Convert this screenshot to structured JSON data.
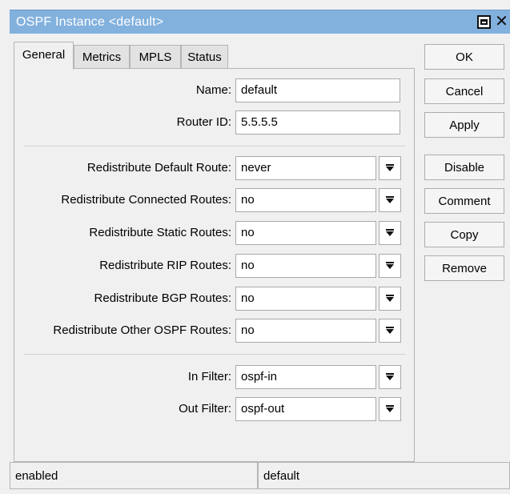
{
  "window": {
    "title": "OSPF Instance <default>",
    "title_bar_color": "#82b1de"
  },
  "tabs": [
    {
      "label": "General",
      "active": true
    },
    {
      "label": "Metrics",
      "active": false
    },
    {
      "label": "MPLS",
      "active": false
    },
    {
      "label": "Status",
      "active": false
    }
  ],
  "form": {
    "name": {
      "label": "Name:",
      "value": "default"
    },
    "router_id": {
      "label": "Router ID:",
      "value": "5.5.5.5"
    },
    "redistribute_default": {
      "label": "Redistribute Default Route:",
      "value": "never"
    },
    "redistribute_connected": {
      "label": "Redistribute Connected Routes:",
      "value": "no"
    },
    "redistribute_static": {
      "label": "Redistribute Static Routes:",
      "value": "no"
    },
    "redistribute_rip": {
      "label": "Redistribute RIP Routes:",
      "value": "no"
    },
    "redistribute_bgp": {
      "label": "Redistribute BGP Routes:",
      "value": "no"
    },
    "redistribute_other_ospf": {
      "label": "Redistribute Other OSPF Routes:",
      "value": "no"
    },
    "in_filter": {
      "label": "In Filter:",
      "value": "ospf-in"
    },
    "out_filter": {
      "label": "Out Filter:",
      "value": "ospf-out"
    }
  },
  "buttons": {
    "ok": "OK",
    "cancel": "Cancel",
    "apply": "Apply",
    "disable": "Disable",
    "comment": "Comment",
    "copy": "Copy",
    "remove": "Remove"
  },
  "icons": {
    "maximize": "maximize-icon",
    "close": "close-icon",
    "dropdown": "dropdown-arrow-icon"
  },
  "status": {
    "state": "enabled",
    "instance": "default"
  }
}
